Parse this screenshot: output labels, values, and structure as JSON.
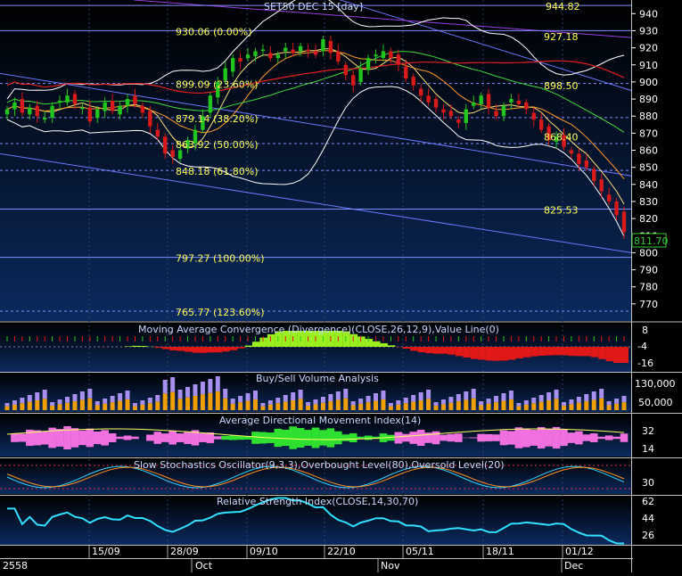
{
  "window": {
    "title": "SET50 DEC 15 [day]"
  },
  "colors": {
    "bg_top": "#000000",
    "bg_bottom": "#0b2a5e",
    "up_candle": "#22c41e",
    "down_candle": "#d91a1a",
    "fib_text": "#ffff55",
    "axis_text": "#ffffff",
    "indicator_title": "#c8d8ff",
    "price_label": "#33cc33"
  },
  "price_axis": {
    "labels": [
      "940",
      "930",
      "920",
      "910",
      "900",
      "890",
      "880",
      "870",
      "860",
      "850",
      "840",
      "830",
      "820",
      "810",
      "800",
      "790",
      "780",
      "770"
    ],
    "last_price": "811.70",
    "top_clip_label": "944.82"
  },
  "fib_levels": {
    "labels": [
      "930.06 (0.00%)",
      "899.09 (23.60%)",
      "879.14 (38.20%)",
      "863.92 (50.00%)",
      "848.18 (61.80%)",
      "797.27 (100.00%)",
      "765.77 (123.60%)"
    ],
    "values": [
      930.06,
      899.09,
      879.14,
      863.92,
      848.18,
      797.27,
      765.77
    ]
  },
  "right_levels": {
    "labels": [
      "944.82",
      "927.18",
      "898.50",
      "868.40",
      "825.53"
    ],
    "values": [
      944.82,
      927.18,
      898.5,
      868.4,
      825.53
    ]
  },
  "indicators": {
    "macd": {
      "title": "Moving Average Convergence (Divergence)(CLOSE,26,12,9),Value Line(0)",
      "axis": [
        "8",
        "-4",
        "-16"
      ]
    },
    "volume": {
      "title": "Buy/Sell Volume Analysis",
      "axis": [
        "130,000",
        "50,000"
      ]
    },
    "adx": {
      "title": "Average Directional Movement Index(14)",
      "axis": [
        "32",
        "14"
      ]
    },
    "stoch": {
      "title": "Slow Stochastics Oscillator(9,3,3),Overbought Level(80),Oversold Level(20)",
      "axis": [
        "30"
      ]
    },
    "rsi": {
      "title": "Relative Strength Index(CLOSE,14,30,70)",
      "axis": [
        "62",
        "44",
        "26"
      ]
    }
  },
  "date_axis": {
    "day_labels": [
      "15/09",
      "28/09",
      "09/10",
      "22/10",
      "05/11",
      "18/11",
      "01/12"
    ],
    "month_labels": [
      "2558",
      "Oct",
      "Nov",
      "Dec"
    ]
  },
  "chart_data": {
    "type": "candlestick",
    "title": "SET50 DEC 15 [day]",
    "ylim": [
      760,
      948
    ],
    "y_axis_ticks": [
      940,
      930,
      920,
      910,
      900,
      890,
      880,
      870,
      860,
      850,
      840,
      830,
      820,
      810,
      800,
      790,
      780,
      770
    ],
    "x_labels": [
      "15/09",
      "28/09",
      "09/10",
      "22/10",
      "05/11",
      "18/11",
      "01/12"
    ],
    "last_close": 811.7,
    "close_series": [
      {
        "name": "close",
        "values": [
          884,
          888,
          882,
          885,
          880,
          879,
          886,
          889,
          892,
          887,
          885,
          877,
          884,
          888,
          883,
          886,
          890,
          887,
          882,
          874,
          868,
          858,
          856,
          860,
          866,
          872,
          880,
          892,
          900,
          908,
          914,
          912,
          916,
          918,
          919,
          914,
          916,
          920,
          917,
          921,
          918,
          916,
          925,
          917,
          912,
          904,
          898,
          908,
          914,
          916,
          918,
          914,
          910,
          902,
          898,
          892,
          888,
          885,
          882,
          880,
          876,
          884,
          888,
          892,
          885,
          880,
          886,
          890,
          887,
          884,
          878,
          872,
          866,
          868,
          862,
          858,
          852,
          850,
          842,
          836,
          830,
          822,
          812
        ]
      }
    ]
  }
}
